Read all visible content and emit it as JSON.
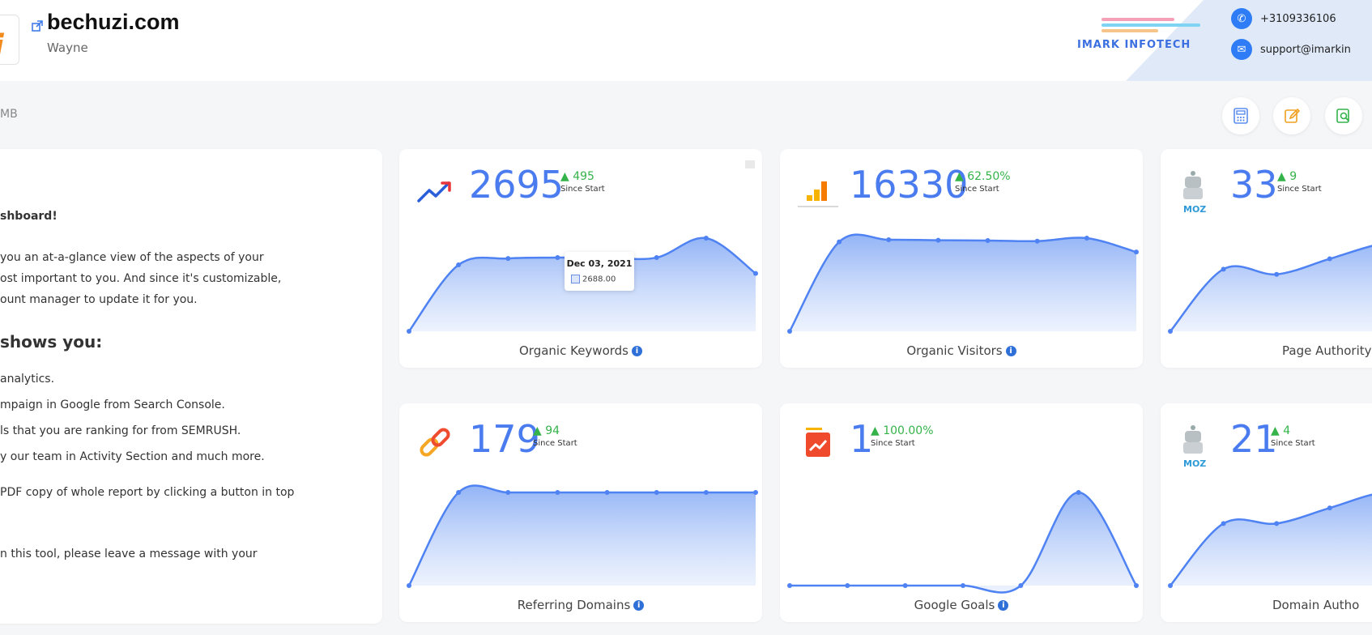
{
  "header": {
    "site_name": "bechuzi.com",
    "owner": "Wayne",
    "brand_name": "IMARK INFOTECH",
    "phone": "+3109336106",
    "email": "support@imarkin",
    "contact_bg_color": "#dfe9f7"
  },
  "breadcrumb": "MB",
  "toolbar": {
    "icons": [
      "calculator-icon",
      "edit-icon",
      "search-report-icon"
    ]
  },
  "welcome": {
    "heading": "shboard!",
    "intro": [
      "you an at-a-glance view of the aspects of your",
      "ost important to you. And since it's customizable,",
      "ount manager to update it for you."
    ],
    "shows_heading": "shows you:",
    "list": [
      "analytics.",
      "mpaign in Google from Search Console.",
      "ls that you are ranking for from SEMRUSH.",
      "y our team in Activity Section and much more.",
      "PDF copy of whole report by clicking a button in top"
    ],
    "footer": "n this tool, please leave a message with your"
  },
  "cards": [
    {
      "id": "organic-keywords",
      "value": "2695",
      "delta": "495",
      "since": "Since Start",
      "label": "Organic Keywords",
      "icon": "trend-up-icon",
      "tooltip": {
        "date": "Dec 03, 2021",
        "value": "2688.00"
      },
      "series": [
        2000,
        2620,
        2680,
        2688,
        2688,
        2688,
        2870,
        2540
      ]
    },
    {
      "id": "organic-visitors",
      "value": "16330",
      "delta": "62.50%",
      "since": "Since Start",
      "label": "Organic Visitors",
      "icon": "google-analytics-icon",
      "series": [
        10000,
        15980,
        16120,
        16090,
        16070,
        16030,
        16230,
        15300
      ]
    },
    {
      "id": "page-authority",
      "value": "33",
      "delta": "9",
      "since": "Since Start",
      "label": "Page Authority",
      "icon": "moz-robot-icon",
      "series": [
        24,
        30,
        29.5,
        31,
        32.5,
        33
      ]
    },
    {
      "id": "referring-domains",
      "value": "179",
      "delta": "94",
      "since": "Since Start",
      "label": "Referring Domains",
      "icon": "link-icon",
      "series": [
        85,
        179,
        179,
        179,
        179,
        179,
        179,
        179
      ]
    },
    {
      "id": "google-goals",
      "value": "1",
      "delta": "100.00%",
      "since": "Since Start",
      "label": "Google Goals",
      "icon": "google-goals-icon",
      "series": [
        0,
        0,
        0,
        0,
        0,
        1,
        0
      ]
    },
    {
      "id": "domain-authority",
      "value": "21",
      "delta": "4",
      "since": "Since Start",
      "label": "Domain Autho",
      "icon": "moz-robot-icon",
      "series": [
        15,
        19,
        19,
        20,
        21,
        21
      ]
    }
  ],
  "colors": {
    "accent": "#4a7cf0",
    "positive": "#35b34a",
    "line": "#4f82f2"
  }
}
